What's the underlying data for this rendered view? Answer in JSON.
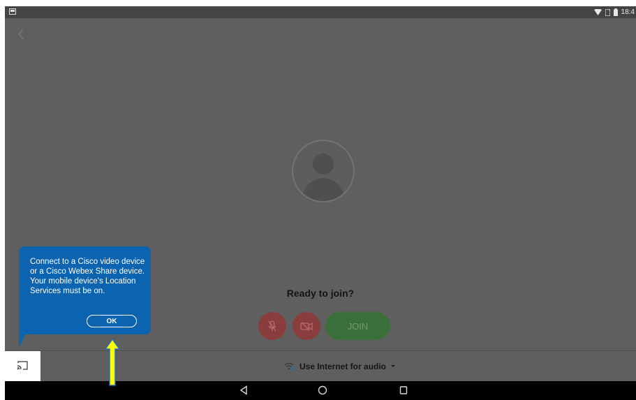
{
  "status_bar": {
    "time": "18:4",
    "icons": [
      "screenshot-icon",
      "wifi-icon",
      "sim-icon",
      "battery-icon"
    ]
  },
  "nav": {
    "back_icon": "chevron-left-icon"
  },
  "main": {
    "avatar_icon": "person-icon",
    "ready_text": "Ready to join?",
    "join_label": "JOIN",
    "mic_icon": "mic-off-icon",
    "camera_icon": "video-off-icon"
  },
  "audio": {
    "label": "Use Internet for audio",
    "icon": "wifi-audio-icon",
    "dropdown_icon": "caret-down-icon"
  },
  "tooltip": {
    "text": "Connect to a Cisco video device or a Cisco Webex Share device. Your mobile device's Location Services must be on.",
    "ok_label": "OK"
  },
  "cast": {
    "icon": "cast-icon"
  },
  "android_nav": {
    "icons": [
      "back-triangle-icon",
      "home-circle-icon",
      "recents-square-icon"
    ]
  },
  "colors": {
    "tooltip": "#0c63b0",
    "join": "#3b6f3a",
    "mute": "#8a3d3d",
    "highlight_arrow": "#ffff00"
  }
}
